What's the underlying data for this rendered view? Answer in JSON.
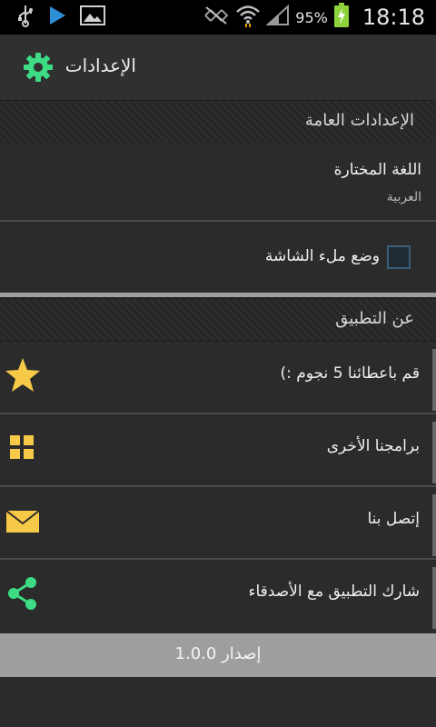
{
  "status_bar": {
    "battery_percent": "95%",
    "time": "18:18",
    "icons": [
      "usb-icon",
      "play-store-icon",
      "gallery-icon",
      "mute-icon",
      "wifi-icon",
      "signal-icon",
      "battery-charging-icon"
    ]
  },
  "action_bar": {
    "title": "الإعدادات",
    "icon": "gear-icon"
  },
  "sections": {
    "general": {
      "header": "الإعدادات العامة"
    },
    "about": {
      "header": "عن التطبيق"
    }
  },
  "prefs": {
    "language": {
      "title": "اللغة المختارة",
      "summary": "العربية"
    },
    "fullscreen": {
      "title": "وضع ملء الشاشة",
      "checked": false
    }
  },
  "about_items": [
    {
      "label": "قم باعطائنا 5 نجوم :)",
      "icon": "star-icon"
    },
    {
      "label": "برامجنا الأخرى",
      "icon": "grid-icon"
    },
    {
      "label": "إتصل بنا",
      "icon": "mail-icon"
    },
    {
      "label": "شارك التطبيق مع الأصدقاء",
      "icon": "share-icon"
    }
  ],
  "version": {
    "label": "إصدار 1.0.0"
  },
  "colors": {
    "accent_green": "#3ddc84",
    "icon_yellow": "#f7c948",
    "background": "#2b2b2b",
    "version_bar": "#9e9e9e"
  }
}
